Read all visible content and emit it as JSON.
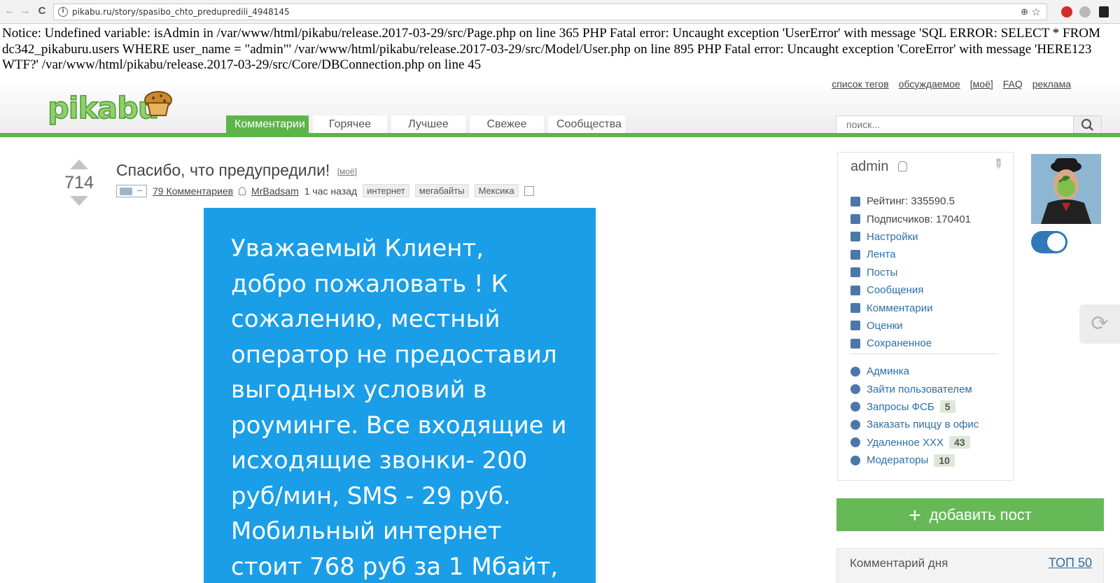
{
  "browser": {
    "url": "pikabu.ru/story/spasibo_chto_predupredili_4948145",
    "nav_back": "←",
    "nav_forward": "→",
    "nav_reload": "C",
    "zoom_icon": "⊕",
    "star_icon": "☆"
  },
  "errors": {
    "text": "Notice: Undefined variable: isAdmin in /var/www/html/pikabu/release.2017-03-29/src/Page.php on line 365 PHP Fatal error: Uncaught exception 'UserError' with message 'SQL ERROR: SELECT * FROM dc342_pikaburu.users WHERE user_name = \"admin\"' /var/www/html/pikabu/release.2017-03-29/src/Model/User.php on line 895 PHP Fatal error: Uncaught exception 'CoreError' with message 'HERE123 WTF?' /var/www/html/pikabu/release.2017-03-29/src/Core/DBConnection.php on line 45"
  },
  "header": {
    "logo": "pikabu",
    "toplinks": [
      "список тегов",
      "обсуждаемое",
      "[моё]",
      "FAQ",
      "реклама"
    ],
    "tabs": [
      {
        "label": "Комментарии",
        "active": true
      },
      {
        "label": "Горячее",
        "active": false
      },
      {
        "label": "Лучшее",
        "active": false
      },
      {
        "label": "Свежее",
        "active": false
      },
      {
        "label": "Сообщества",
        "active": false
      }
    ],
    "search_placeholder": "поиск..."
  },
  "story": {
    "rating": "714",
    "title": "Спасибо, что предупредили!",
    "moe": "[моё]",
    "comments": "79 Комментариев",
    "author": "MrBadsam",
    "time": "1 час назад",
    "tags": [
      "интернет",
      "мегабайты",
      "Мексика"
    ],
    "image_text": "Уважаемый Клиент,\nдобро пожаловать ! К\nсожалению, местный\nоператор не предоставил\nвыгодных условий в\nроуминге. Все входящие и\nисходящие звонки- 200\nруб/мин, SMS - 29 руб.\nМобильный интернет\nстоит 768 руб за 1 Мбайт,"
  },
  "profile": {
    "name": "admin",
    "rating_label": "Рейтинг: 335590.5",
    "subscribers_label": "Подписчиков: 170401",
    "menu": [
      "Настройки",
      "Лента",
      "Посты",
      "Сообщения",
      "Комментарии",
      "Оценки",
      "Сохраненное"
    ],
    "admin_menu": [
      {
        "label": "Админка",
        "badge": ""
      },
      {
        "label": "Зайти пользователем",
        "badge": ""
      },
      {
        "label": "Запросы ФСБ",
        "badge": "5"
      },
      {
        "label": "Заказать пиццу в офис",
        "badge": ""
      },
      {
        "label": "Удаленное XXX",
        "badge": "43"
      },
      {
        "label": "Модераторы",
        "badge": "10"
      }
    ]
  },
  "sidebar": {
    "add_post": "добавить пост",
    "comment_day": "Комментарий дня",
    "top50": "ТОП 50"
  },
  "colors": {
    "brand_green": "#5db44a",
    "image_blue": "#1a9ee8",
    "link_blue": "#2c6fa8"
  }
}
